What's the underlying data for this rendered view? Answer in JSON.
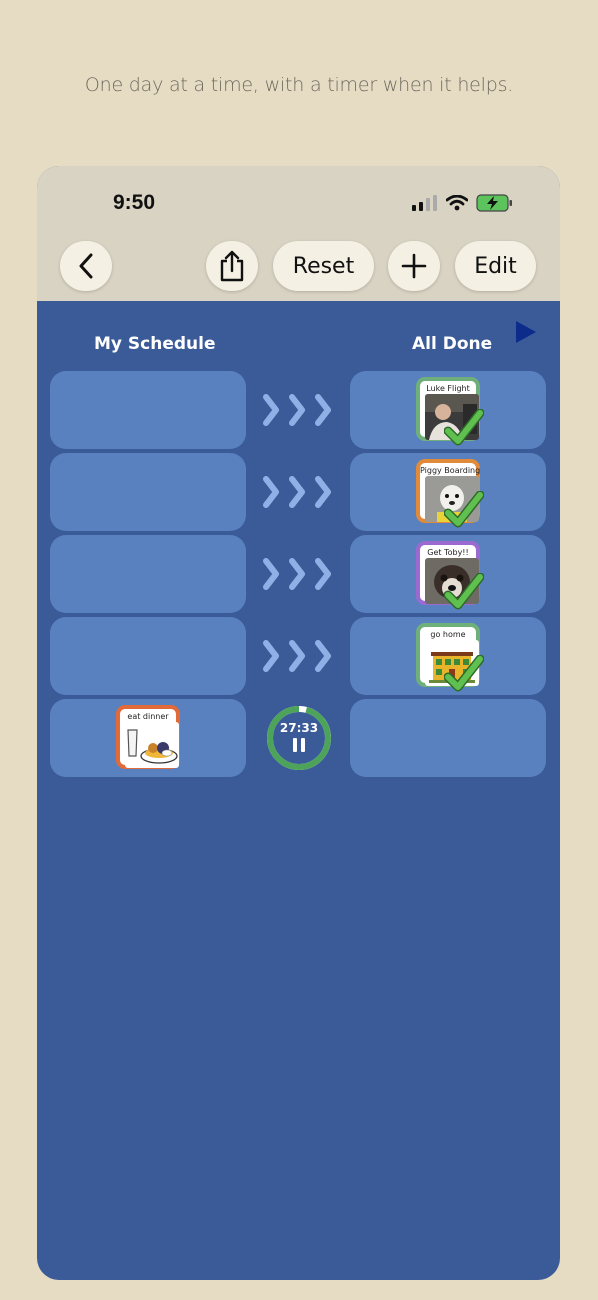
{
  "tagline": "One day at a time, with a timer when it helps.",
  "status_bar": {
    "time": "9:50"
  },
  "toolbar": {
    "reset_label": "Reset",
    "edit_label": "Edit"
  },
  "columns": {
    "left_header": "My Schedule",
    "right_header": "All Done"
  },
  "done_items": [
    {
      "label": "Luke Flight",
      "border": "#6fb07a",
      "done": true
    },
    {
      "label": "Piggy Boarding",
      "border": "#e08a3a",
      "done": true
    },
    {
      "label": "Get Toby!!",
      "border": "#9b6ad1",
      "done": true
    },
    {
      "label": "go home",
      "border": "#6fb07a",
      "done": true
    }
  ],
  "current_item": {
    "label": "eat dinner",
    "border": "#e06a3a"
  },
  "timer": {
    "display": "27:33",
    "remaining_fraction": 0.96,
    "ring_color": "#4ea35a"
  },
  "colors": {
    "background": "#e6dcc4",
    "schedule_bg": "#3a5b98",
    "slot": "#5a81bf"
  }
}
